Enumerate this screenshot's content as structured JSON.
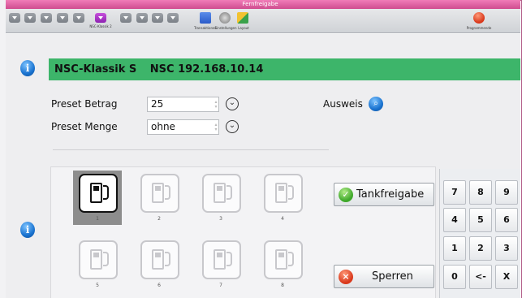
{
  "window": {
    "title": "Fernfreigabe"
  },
  "toolbar": {
    "tab_label": "NSC-Klassik 2",
    "transactions_label": "Transaktionen",
    "settings_label": "Einstellungen",
    "layout_label": "Layout",
    "exit_label": "Programmende"
  },
  "header": {
    "device_name": "NSC-Klassik S",
    "device_address": "NSC 192.168.10.14"
  },
  "form": {
    "preset_amount_label": "Preset Betrag",
    "preset_amount_value": "25",
    "preset_quantity_label": "Preset Menge",
    "preset_quantity_value": "ohne",
    "id_label": "Ausweis"
  },
  "pumps": [
    {
      "number": "1",
      "selected": true
    },
    {
      "number": "2",
      "selected": false
    },
    {
      "number": "3",
      "selected": false
    },
    {
      "number": "4",
      "selected": false
    },
    {
      "number": "5",
      "selected": false
    },
    {
      "number": "6",
      "selected": false
    },
    {
      "number": "7",
      "selected": false
    },
    {
      "number": "8",
      "selected": false
    }
  ],
  "actions": {
    "release_label": "Tankfreigabe",
    "lock_label": "Sperren"
  },
  "keypad": [
    "7",
    "8",
    "9",
    "4",
    "5",
    "6",
    "1",
    "2",
    "3",
    "0",
    "<-",
    "X"
  ],
  "colors": {
    "accent_green": "#3db56a",
    "title_pink": "#e066a6",
    "info_blue": "#1a73d0"
  }
}
